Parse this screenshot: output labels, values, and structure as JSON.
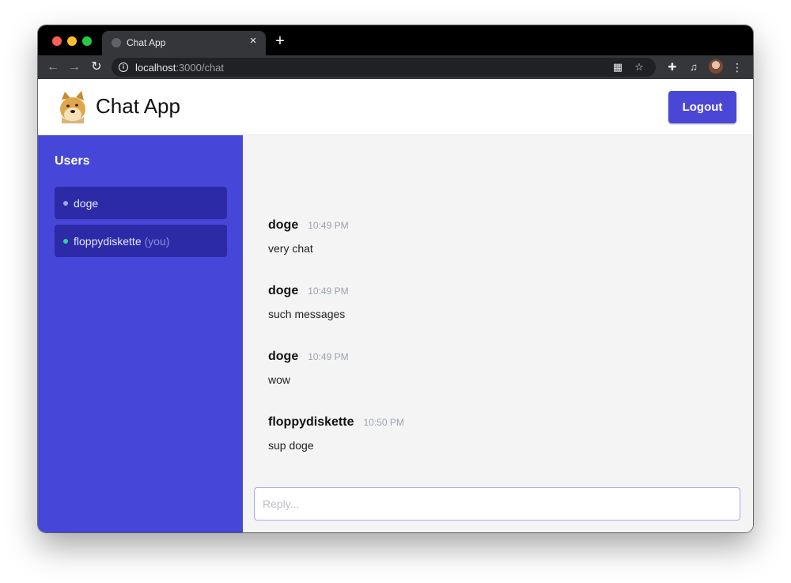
{
  "browser": {
    "tab_title": "Chat App",
    "url_host": "localhost",
    "url_path": ":3000/chat"
  },
  "app": {
    "title": "Chat App",
    "logout_label": "Logout"
  },
  "sidebar": {
    "title": "Users",
    "users": [
      {
        "name": "doge",
        "suffix": "",
        "dot_color": "#a5a8f0"
      },
      {
        "name": "floppydiskette",
        "suffix": "(you)",
        "dot_color": "#34d399"
      }
    ]
  },
  "messages": [
    {
      "author": "doge",
      "time": "10:49 PM",
      "text": "very chat"
    },
    {
      "author": "doge",
      "time": "10:49 PM",
      "text": "such messages"
    },
    {
      "author": "doge",
      "time": "10:49 PM",
      "text": "wow"
    },
    {
      "author": "floppydiskette",
      "time": "10:50 PM",
      "text": "sup doge"
    }
  ],
  "composer": {
    "placeholder": "Reply...",
    "value": ""
  },
  "colors": {
    "sidebar_bg": "#4646d8",
    "user_item_bg": "#2d2aa8",
    "accent_button": "#4a47d7"
  }
}
